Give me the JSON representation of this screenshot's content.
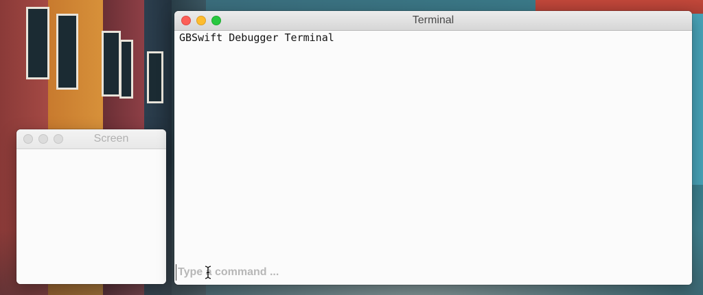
{
  "terminal_window": {
    "title": "Terminal",
    "output_text": "GBSwift Debugger Terminal",
    "input_placeholder": "Type a command ...",
    "input_value": ""
  },
  "screen_window": {
    "title": "Screen"
  },
  "icons": {
    "close": "close-icon",
    "minimize": "minimize-icon",
    "zoom": "zoom-icon",
    "cursor": "ibeam-cursor-icon"
  },
  "colors": {
    "close": "#fc5f57",
    "minimize": "#fdbc2e",
    "zoom": "#28c840",
    "inactive_light": "#dcdcdc"
  }
}
